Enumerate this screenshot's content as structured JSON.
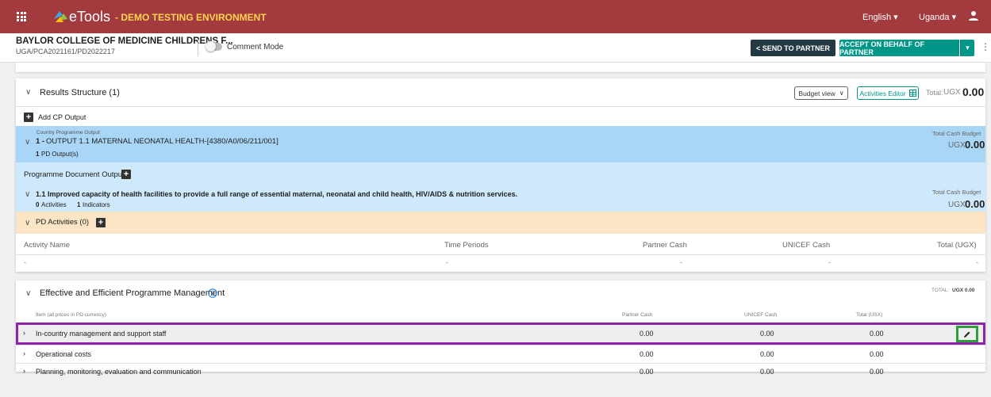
{
  "app": {
    "brand": "eTools",
    "environment": "- DEMO TESTING ENVIRONMENT",
    "language": "English ▾",
    "country": "Uganda ▾"
  },
  "header": {
    "partner_name": "BAYLOR COLLEGE OF MEDICINE CHILDRENS F...",
    "pd_reference": "UGA/PCA2021161/PD2022217",
    "comment_mode_label": "Comment Mode",
    "send_to_partner_label": "< SEND TO PARTNER",
    "accept_label": "ACCEPT ON BEHALF OF PARTNER"
  },
  "results_structure": {
    "title": "Results Structure (1)",
    "budget_view_label": "Budget view",
    "activities_editor_label": "Activities Editor",
    "total_label": "Total:",
    "total_currency": "UGX",
    "total_value": "0.00",
    "add_cp_output_label": "Add CP Output",
    "cp_output": {
      "caption": "Country Programme Output",
      "number": "1 -",
      "title": "OUTPUT 1.1 MATERNAL NEONATAL HEALTH-[4380/A0/06/211/001]",
      "pd_outputs_count": "1",
      "pd_outputs_label": "PD Output(s)",
      "budget_caption": "Total Cash Budget",
      "budget_currency": "UGX",
      "budget_value": "0.00"
    },
    "pd_outputs_label": "Programme Document Outputs",
    "pd_output": {
      "title": "1.1 Improved capacity of health facilities to provide a full range of essential maternal, neonatal and child health, HIV/AIDS & nutrition services.",
      "activities_count": "0",
      "activities_label": "Activities",
      "indicators_count": "1",
      "indicators_label": "Indicators",
      "budget_caption": "Total Cash Budget",
      "budget_currency": "UGX",
      "budget_value": "0.00"
    },
    "pd_activities_label": "PD Activities (0)",
    "activities_table": {
      "columns": [
        "Activity Name",
        "Time Periods",
        "Partner Cash",
        "UNICEF Cash",
        "Total (UGX)"
      ],
      "row": [
        "-",
        "-",
        "-",
        "-",
        "-"
      ]
    }
  },
  "management": {
    "title": "Effective and Efficient Programme Management",
    "total_label": "TOTAL:",
    "total_value": "UGX 0.00",
    "columns": [
      "Item (all prices in PD currency)",
      "Partner Cash",
      "UNICEF Cash",
      "Total (USX)"
    ],
    "rows": [
      {
        "name": "In-country management and support staff",
        "partner": "0.00",
        "unicef": "0.00",
        "total": "0.00"
      },
      {
        "name": "Operational costs",
        "partner": "0.00",
        "unicef": "0.00",
        "total": "0.00"
      },
      {
        "name": "Planning, monitoring, evaluation and communication",
        "partner": "0.00",
        "unicef": "0.00",
        "total": "0.00"
      }
    ]
  },
  "colors": {
    "topbar": "#a33a3e",
    "env_text": "#ffd54f",
    "cp_output_bg": "#a9d6f7",
    "pd_output_bg": "#cde9fb",
    "pd_activities_bg": "#fbe5c5",
    "accept_button": "#009688",
    "send_button": "#233944",
    "row_highlight": "#8e24aa",
    "edit_highlight": "#2e9e3e"
  }
}
